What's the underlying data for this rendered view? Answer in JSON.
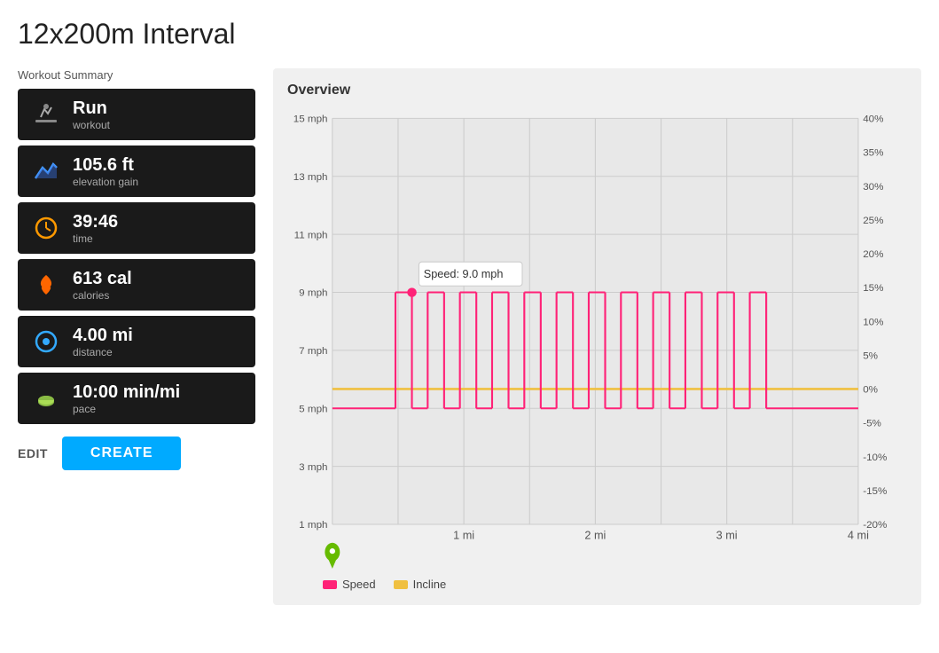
{
  "page": {
    "title": "12x200m Interval"
  },
  "sidebar": {
    "section_label": "Workout Summary",
    "stats": [
      {
        "id": "run",
        "icon": "🔧",
        "value": "Run",
        "label": "workout",
        "icon_name": "run-icon"
      },
      {
        "id": "elevation",
        "icon": "📈",
        "value": "105.6 ft",
        "label": "elevation gain",
        "icon_name": "elevation-icon"
      },
      {
        "id": "time",
        "icon": "⏱",
        "value": "39:46",
        "label": "time",
        "icon_name": "timer-icon"
      },
      {
        "id": "calories",
        "icon": "🔥",
        "value": "613 cal",
        "label": "calories",
        "icon_name": "fire-icon"
      },
      {
        "id": "distance",
        "icon": "🔵",
        "value": "4.00 mi",
        "label": "distance",
        "icon_name": "distance-icon"
      },
      {
        "id": "pace",
        "icon": "👟",
        "value": "10:00 min/mi",
        "label": "pace",
        "icon_name": "pace-icon"
      }
    ],
    "edit_label": "EDIT",
    "create_label": "CREATE"
  },
  "chart": {
    "title": "Overview",
    "tooltip": "Speed: 9.0 mph",
    "legend": {
      "speed_label": "Speed",
      "incline_label": "Incline"
    },
    "colors": {
      "speed": "#ff2277",
      "incline": "#f0c040",
      "grid": "#d0d0d0",
      "background": "#f0f0f0"
    }
  }
}
